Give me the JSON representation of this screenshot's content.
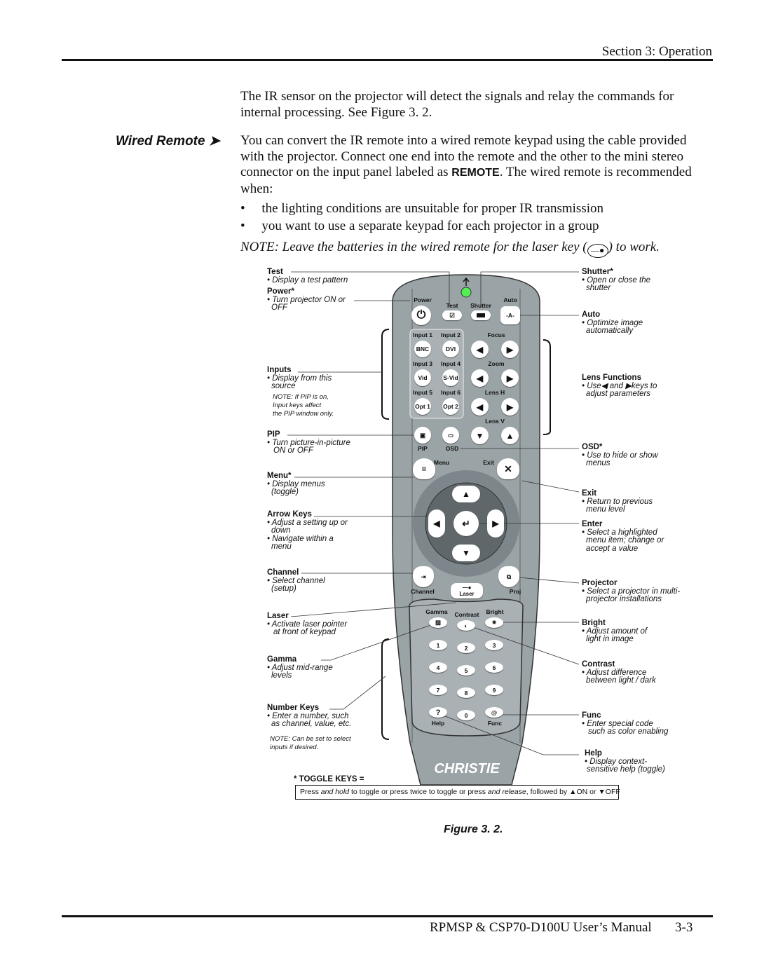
{
  "header": {
    "section": "Section 3: Operation"
  },
  "intro": "The IR sensor on the projector will detect the signals and relay the commands for internal processing. See Figure 3. 2.",
  "sidehead": "Wired Remote",
  "para1a": "You can convert the IR remote into a wired remote keypad using the cable provided with the projector. Connect one end into the remote and the other to the mini stereo connector on the input panel labeled as ",
  "para1b": "REMOTE",
  "para1c": ". The wired remote is recommended when:",
  "bullets": [
    "the lighting conditions are unsuitable for proper IR transmission",
    "you want to use a separate keypad for each projector in a group"
  ],
  "note_a": "NOTE: Leave the batteries in the wired remote for the laser key (",
  "note_b": ") to work.",
  "callouts_left": [
    {
      "title": "Test",
      "lines": [
        "• Display a test pattern"
      ]
    },
    {
      "title": "Power*",
      "lines": [
        "• Turn projector ON or",
        "  OFF"
      ]
    },
    {
      "title": "Inputs",
      "lines": [
        "• Display from this",
        "  source"
      ],
      "note": [
        "NOTE: If PIP is on,",
        "Input keys affect",
        "the PIP window only."
      ]
    },
    {
      "title": "PIP",
      "lines": [
        "• Turn picture-in-picture",
        "  ON or OFF"
      ]
    },
    {
      "title": "Menu*",
      "lines": [
        "• Display menus",
        "  (toggle)"
      ]
    },
    {
      "title": "Arrow Keys",
      "lines": [
        "• Adjust a setting up or",
        "  down",
        "• Navigate within a",
        "  menu"
      ]
    },
    {
      "title": "Channel",
      "lines": [
        "• Select channel",
        "  (setup)"
      ]
    },
    {
      "title": "Laser",
      "lines": [
        "• Activate laser pointer",
        "  at front of keypad"
      ]
    },
    {
      "title": "Gamma",
      "lines": [
        "• Adjust mid-range",
        "  levels"
      ]
    },
    {
      "title": "Number Keys",
      "lines": [
        "• Enter a number, such",
        "  as channel, value, etc."
      ],
      "note": [
        "NOTE: Can be set to select",
        "inputs if desired."
      ]
    }
  ],
  "callouts_right": [
    {
      "title": "Shutter*",
      "lines": [
        "• Open or close the",
        "  shutter"
      ]
    },
    {
      "title": "Auto",
      "lines": [
        "• Optimize image",
        "  automatically"
      ]
    },
    {
      "title": "Lens Functions",
      "lines": [
        "• Use◀ and ▶keys to",
        "  adjust parameters"
      ]
    },
    {
      "title": "OSD*",
      "lines": [
        "• Use to hide or show",
        "  menus"
      ]
    },
    {
      "title": "Exit",
      "lines": [
        "• Return to previous",
        "  menu level"
      ]
    },
    {
      "title": "Enter",
      "lines": [
        "• Select a highlighted",
        "  menu item; change or",
        "  accept a value"
      ]
    },
    {
      "title": "Projector",
      "lines": [
        "• Select a projector in multi-",
        "  projector installations"
      ]
    },
    {
      "title": "Bright",
      "lines": [
        "• Adjust amount of",
        "  light in image"
      ]
    },
    {
      "title": "Contrast",
      "lines": [
        "• Adjust difference",
        "  between light / dark"
      ]
    },
    {
      "title": "Func",
      "lines": [
        "• Enter special code",
        "  such as color enabling"
      ]
    },
    {
      "title": "Help",
      "lines": [
        "• Display context-",
        "  sensitive help (toggle)"
      ]
    }
  ],
  "remote": {
    "labels": {
      "power": "Power",
      "test": "Test",
      "shutter": "Shutter",
      "auto": "Auto",
      "input1": "Input 1",
      "input2": "Input 2",
      "input3": "Input 3",
      "input4": "Input 4",
      "input5": "Input 5",
      "input6": "Input 6",
      "focus": "Focus",
      "zoom": "Zoom",
      "lensh": "Lens H",
      "lensv": "Lens V",
      "pip": "PIP",
      "osd": "OSD",
      "menu": "Menu",
      "exit": "Exit",
      "channel": "Channel",
      "laser": "Laser",
      "proj": "Proj",
      "gamma": "Gamma",
      "contrast": "Contrast",
      "bright": "Bright",
      "help": "Help",
      "func": "Func"
    },
    "keys": {
      "bnc": "BNC",
      "dvi": "DVI",
      "vid": "Vid",
      "svid": "S-Vid",
      "opt1": "Opt 1",
      "opt2": "Opt 2",
      "digits": [
        "1",
        "2",
        "3",
        "4",
        "5",
        "6",
        "7",
        "8",
        "9",
        "0"
      ],
      "help": "?"
    },
    "logo": "CHRISTIE",
    "body_color": "#9aa3a6"
  },
  "toggle": {
    "title": "* TOGGLE KEYS =",
    "t1": "Press ",
    "t2": "and hold",
    "t3": " to toggle or press twice to toggle or press ",
    "t4": "and release",
    "t5": ", followed by ▲ON or ▼OFF"
  },
  "caption": "Figure 3. 2.",
  "footer": {
    "manual": "RPMSP & CSP70-D100U User’s Manual",
    "page": "3-3"
  }
}
